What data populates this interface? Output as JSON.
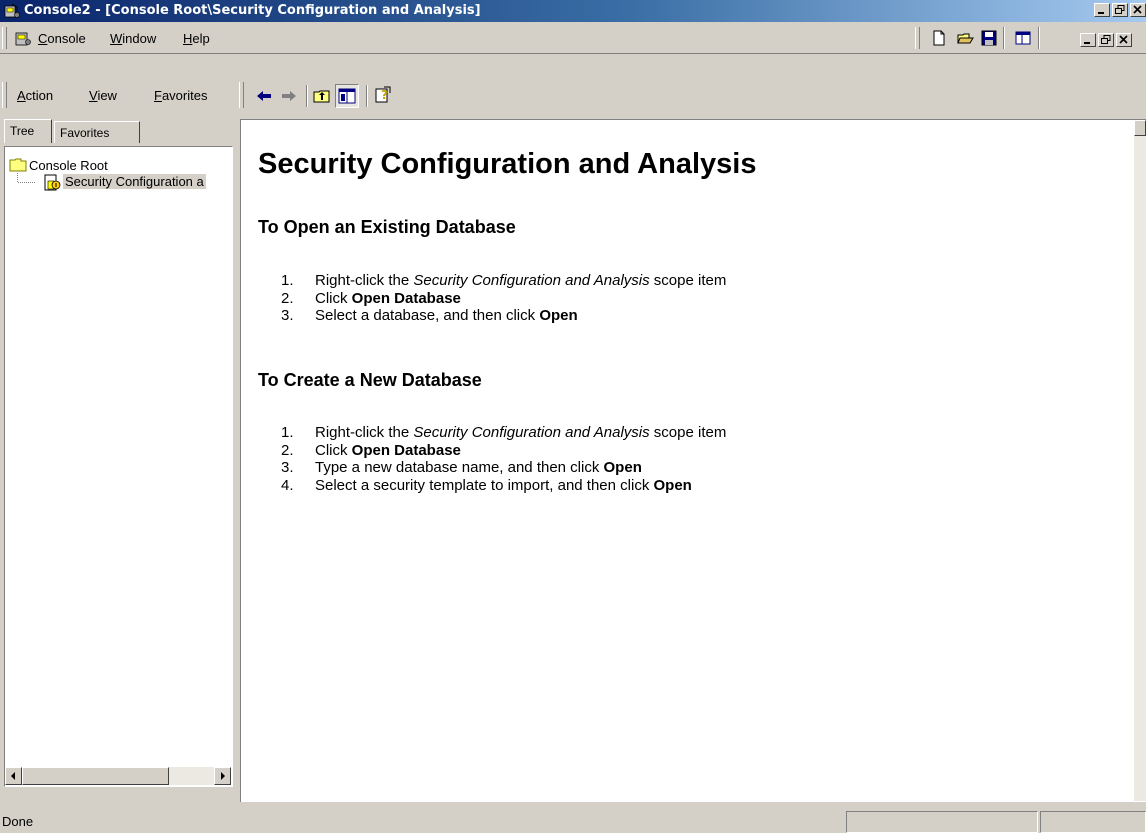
{
  "window": {
    "title": "Console2 - [Console Root\\Security Configuration and Analysis]"
  },
  "menubar": {
    "items": [
      {
        "label": "Console",
        "accel": "C"
      },
      {
        "label": "Window",
        "accel": "W"
      },
      {
        "label": "Help",
        "accel": "H"
      }
    ]
  },
  "actionbar": {
    "items": [
      {
        "label": "Action",
        "accel": "A"
      },
      {
        "label": "View",
        "accel": "V"
      },
      {
        "label": "Favorites",
        "accel": "F"
      }
    ]
  },
  "left_pane": {
    "tabs": [
      "Tree",
      "Favorites"
    ],
    "tree": [
      {
        "label": "Console Root",
        "icon": "folder-icon"
      },
      {
        "label": "Security Configuration a",
        "icon": "security-snapin-icon"
      }
    ]
  },
  "content": {
    "heading": "Security Configuration and Analysis",
    "sections": [
      {
        "title": "To Open an Existing Database",
        "steps": [
          {
            "num": "1.",
            "parts": [
              {
                "t": "Right-click the "
              },
              {
                "t": "Security Configuration and Analysis",
                "s": "i"
              },
              {
                "t": " scope item"
              }
            ]
          },
          {
            "num": "2.",
            "parts": [
              {
                "t": "Click "
              },
              {
                "t": "Open Database",
                "s": "b"
              }
            ]
          },
          {
            "num": "3.",
            "parts": [
              {
                "t": "Select a database, and then click "
              },
              {
                "t": "Open",
                "s": "b"
              }
            ]
          }
        ]
      },
      {
        "title": "To Create a New Database",
        "steps": [
          {
            "num": "1.",
            "parts": [
              {
                "t": "Right-click the "
              },
              {
                "t": "Security Configuration and Analysis",
                "s": "i"
              },
              {
                "t": " scope item"
              }
            ]
          },
          {
            "num": "2.",
            "parts": [
              {
                "t": "Click "
              },
              {
                "t": "Open Database",
                "s": "b"
              }
            ]
          },
          {
            "num": "3.",
            "parts": [
              {
                "t": "Type a new database name, and then click "
              },
              {
                "t": "Open",
                "s": "b"
              }
            ]
          },
          {
            "num": "4.",
            "parts": [
              {
                "t": "Select a security template to import, and then click "
              },
              {
                "t": "Open",
                "s": "b"
              }
            ]
          }
        ]
      }
    ]
  },
  "status": {
    "text": "Done"
  },
  "colors": {
    "titlebar_start": "#0a246a",
    "titlebar_end": "#a6caf0",
    "face": "#d4d0c8"
  }
}
